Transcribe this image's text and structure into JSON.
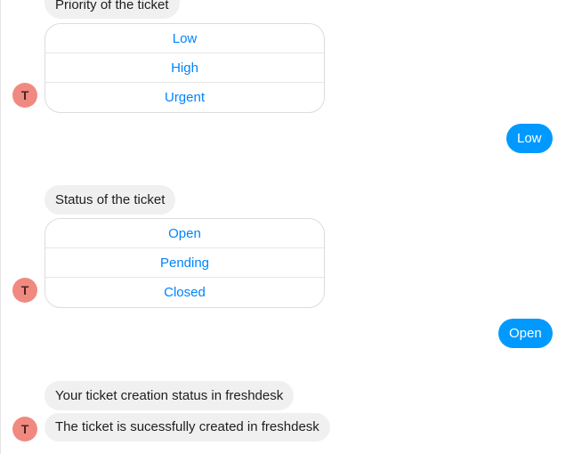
{
  "conversation": {
    "priority_prompt": "Priority of the ticket",
    "priority_options": [
      "Low",
      "High",
      "Urgent"
    ],
    "priority_reply": "Low",
    "status_prompt": "Status of the ticket",
    "status_options": [
      "Open",
      "Pending",
      "Closed"
    ],
    "status_reply": "Open",
    "creation_status_message": "Your ticket creation status in freshdesk",
    "success_message": "The ticket is sucessfully created in freshdesk"
  },
  "bot_avatar": {
    "initial": "T",
    "color": "#f08a80"
  },
  "colors": {
    "user_bubble": "#0099ff",
    "option_text": "#0084ff",
    "bot_bubble": "#f0f0f0"
  }
}
